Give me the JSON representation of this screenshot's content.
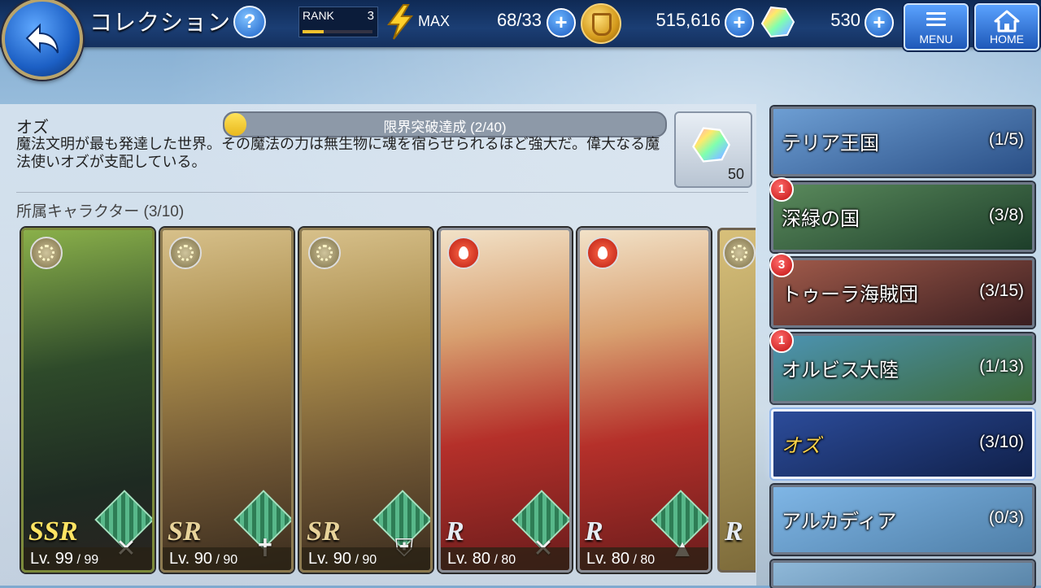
{
  "header": {
    "title": "コレクション",
    "help_label": "?",
    "rank_label": "RANK",
    "rank_value": "3",
    "rank_progress": 0.3,
    "stamina_label": "MAX",
    "stamina_value": "68/33",
    "coins_value": "515,616",
    "gems_value": "530",
    "plus_label": "+",
    "menu_label": "MENU",
    "home_label": "HOME"
  },
  "world": {
    "name": "オズ",
    "progress_text": "限界突破達成 (2/40)",
    "progress_fraction": 0.05,
    "description": "魔法文明が最も発達した世界。その魔法の力は無生物に魂を宿らせられるほど強大だ。偉大なる魔法使いオズが支配している。",
    "reward_qty": "50",
    "characters_title": "所属キャラクター (3/10)"
  },
  "characters": [
    {
      "rarity": "SSR",
      "element": "light-icon",
      "weapon": "crossbow-icon",
      "level": "99",
      "max_level": "99",
      "frame": "#7c8a3a"
    },
    {
      "rarity": "SR",
      "element": "light-icon",
      "weapon": "cross-icon",
      "level": "90",
      "max_level": "90",
      "frame": "#8c7a50"
    },
    {
      "rarity": "SR",
      "element": "light-icon",
      "weapon": "shield-icon",
      "level": "90",
      "max_level": "90",
      "frame": "#8c7a50"
    },
    {
      "rarity": "R",
      "element": "fire-icon",
      "weapon": "crossbow-icon",
      "level": "80",
      "max_level": "80",
      "frame": "#8a8e96"
    },
    {
      "rarity": "R",
      "element": "fire-icon",
      "weapon": "hat-icon",
      "level": "80",
      "max_level": "80",
      "frame": "#8a8e96"
    },
    {
      "rarity": "R",
      "element": "light-icon",
      "weapon": "",
      "level": "",
      "max_level": "",
      "frame": "#8a8e96"
    }
  ],
  "lv_prefix": "Lv. ",
  "world_list": [
    {
      "name": "テリア王国",
      "count": "(1/5)",
      "badge": "",
      "selected": false,
      "colors": [
        "#6d9ed3",
        "#2a4f86"
      ]
    },
    {
      "name": "深緑の国",
      "count": "(3/8)",
      "badge": "1",
      "selected": false,
      "colors": [
        "#5a8a5c",
        "#1d3e2a"
      ]
    },
    {
      "name": "トゥーラ海賊団",
      "count": "(3/15)",
      "badge": "3",
      "selected": false,
      "colors": [
        "#a05a4a",
        "#3a1e20"
      ]
    },
    {
      "name": "オルビス大陸",
      "count": "(1/13)",
      "badge": "1",
      "selected": false,
      "colors": [
        "#4c93b2",
        "#3c6a3a"
      ]
    },
    {
      "name": "オズ",
      "count": "(3/10)",
      "badge": "",
      "selected": true,
      "colors": [
        "#2c4c9a",
        "#10204a"
      ]
    },
    {
      "name": "アルカディア",
      "count": "(0/3)",
      "badge": "",
      "selected": false,
      "colors": [
        "#7fb6e6",
        "#4f7fa8"
      ]
    }
  ]
}
